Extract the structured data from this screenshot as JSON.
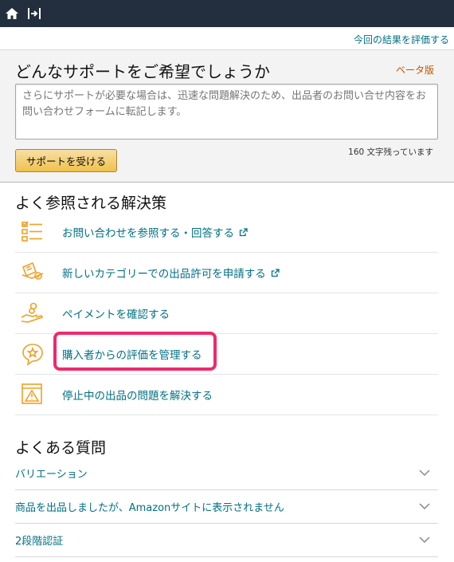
{
  "topbar": {
    "icons": [
      "home-icon",
      "collapse-sidebar-icon"
    ]
  },
  "header": {
    "rate_link": "今回の結果を評価する"
  },
  "support": {
    "title": "どんなサポートをご希望でしょうか",
    "beta": "ベータ版",
    "placeholder": "さらにサポートが必要な場合は、迅速な問題解決のため、出品者のお問い合せ内容をお問い合わせフォームに転記します。",
    "char_count": "160 文字残っています",
    "button_label": "サポートを受ける"
  },
  "solutions": {
    "title": "よく参照される解決策",
    "items": [
      {
        "label": "お問い合わせを参照する・回答する",
        "icon": "checklist-icon",
        "external": true
      },
      {
        "label": "新しいカテゴリーでの出品許可を申請する",
        "icon": "category-approval-icon",
        "external": true
      },
      {
        "label": "ペイメントを確認する",
        "icon": "payment-hand-icon",
        "external": false
      },
      {
        "label": "購入者からの評価を管理する",
        "icon": "feedback-star-icon",
        "external": false
      },
      {
        "label": "停止中の出品の問題を解決する",
        "icon": "warning-document-icon",
        "external": false
      }
    ]
  },
  "faq": {
    "title": "よくある質問",
    "items": [
      {
        "label": "バリエーション"
      },
      {
        "label": "商品を出品しましたが、Amazonサイトに表示されません"
      },
      {
        "label": "2段階認証"
      }
    ]
  },
  "colors": {
    "topbar": "#232f3e",
    "link": "#007185",
    "accent_orange": "#f0a024",
    "highlight": "#ef2a6a",
    "button": "#f0c14b"
  }
}
